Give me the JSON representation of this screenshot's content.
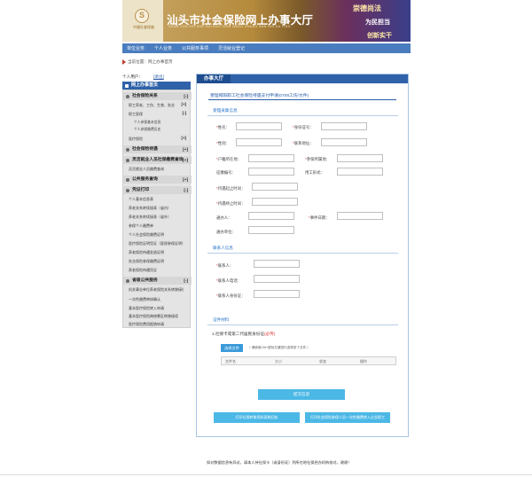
{
  "banner": {
    "logo_text": "中國社會保險",
    "title": "汕头市社会保险网上办事大厅",
    "pinyin": "SHAN TOU SHI SHE HUI BAO XIAN WANG SHANG BAN SHI DA TING",
    "slogan_1": "崇德尚法",
    "slogan_2": "为民担当",
    "slogan_3": "创新实干"
  },
  "nav": {
    "items": [
      {
        "label": "单位业务"
      },
      {
        "label": "个人业务"
      },
      {
        "label": "公共服务事项"
      },
      {
        "label": "灵活就业登记"
      }
    ]
  },
  "breadcrumb": "当前位置：网上办事首页",
  "sidebar": {
    "user_label": "个人用户：",
    "exit_label": "[退出]",
    "head": "网上办事首页",
    "groups": [
      {
        "label": "社会保险关系",
        "toggle": "[-]"
      },
      {
        "label": "社会保险待遇",
        "toggle": "[+]"
      },
      {
        "label": "灵活就业人员社保缴费查询",
        "toggle": "[+]"
      },
      {
        "label": "公共服务查询",
        "toggle": "[+]"
      },
      {
        "label": "凭证打印",
        "toggle": "[-]"
      },
      {
        "label": "省级公共服务",
        "toggle": "[-]"
      }
    ],
    "items_g1": [
      {
        "label": "职工养老、工伤、生育、失业",
        "toggle": "[+]"
      },
      {
        "label": "职工医保",
        "toggle": "[-]"
      },
      {
        "label": "医疗保险",
        "toggle": "[+]"
      }
    ],
    "subs_g1": [
      "个人参保基本信息",
      "个人参保缴费历史"
    ],
    "items_g3": [
      "灵活就业人员缴费查询"
    ],
    "items_g5": [
      "个人基本信息表",
      "养老关系转续接表（省内）",
      "养老关系转续接表（省外）",
      "参保个人缴费单",
      "个人社会保险缴费证明",
      "医疗保险证明凭证（医保参保证明）",
      "养老保险待遇发放证明",
      "失业保险参保缴费证明",
      "养老保险待遇凭证"
    ],
    "items_g6": [
      "机关事业单位养老保险关系转移接续申请",
      "一次性缴费审核确认",
      "基本医疗保险转入申请",
      "基本医疗保险跨统筹区转移接续",
      "医疗保险费用报销申请"
    ]
  },
  "main": {
    "tab": "办事大厅",
    "form_title": "受理揭阳职工社会保险待遇支付申请(0708工伤/文件)",
    "section_apply": "受理采集信息",
    "section_contact": "联系人信息",
    "section_upload": "证件材料",
    "fields_two_col": [
      {
        "left": "姓名：",
        "left_req": true,
        "right": "身份证号：",
        "right_req": true
      },
      {
        "left": "性别：",
        "left_req": true,
        "right": "联系地址：",
        "right_req": true
      },
      {
        "left": "户籍所在地：",
        "left_req": true,
        "right": "参保所属地：",
        "right_req": true
      },
      {
        "left": "征缴编号：",
        "left_req": false,
        "right": "用工形式：",
        "right_req": false
      }
    ],
    "fields_single": [
      {
        "label": "待遇起止时间：",
        "req": true
      },
      {
        "label": "待遇终止时间：",
        "req": true
      }
    ],
    "field_handler": "通办人：",
    "field_date": "事件日期：",
    "field_date_req": true,
    "field_unit": "通办单位：",
    "contact_fields": [
      {
        "label": "联系人：",
        "req": true
      },
      {
        "label": "联系人电话：",
        "req": true
      },
      {
        "label": "联系人身份证：",
        "req": true
      }
    ],
    "upload_title": "1.社保卡或第二代居民身份证",
    "upload_required": "(必传)",
    "select_file_button": "选择文件",
    "upload_hint": "（ 请使用Ctrl+鼠标左键进行选择多个文件 ）",
    "table_headers": [
      "文件名",
      "大小",
      "状态",
      "操作"
    ],
    "submit_button": "提交信息",
    "print_button_1": "打印社保转移资料表和回执",
    "print_button_2": "打印社会保险参保人员一次性缴费转入企业职工"
  },
  "footer": "如对数据信息有异议，请本人持社保卡（或身份证）到所在地社保经办机构核对。谢谢！"
}
